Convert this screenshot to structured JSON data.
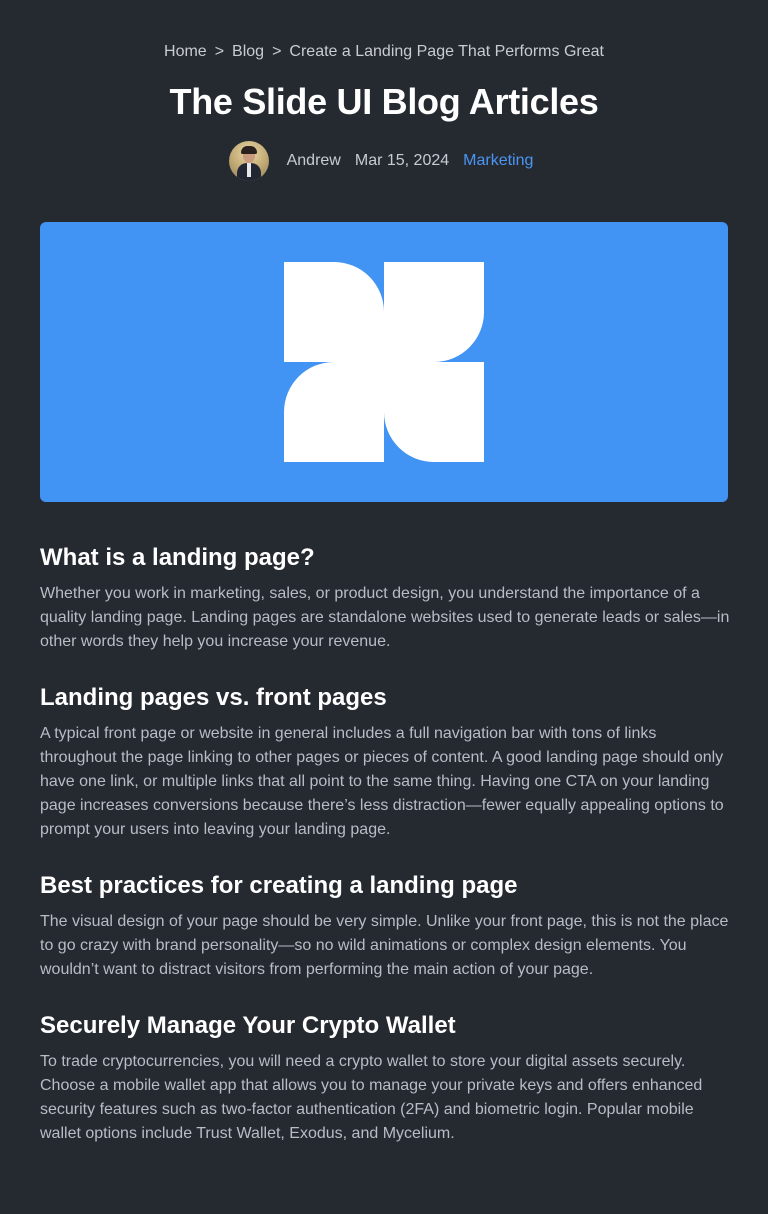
{
  "breadcrumb": {
    "home": "Home",
    "sep1": ">",
    "blog": "Blog",
    "sep2": ">",
    "current": "Create a Landing Page That Performs Great"
  },
  "title": "The Slide UI Blog Articles",
  "meta": {
    "author": "Andrew",
    "date": "Mar 15, 2024",
    "category": "Marketing"
  },
  "colors": {
    "background": "#252a31",
    "accent": "#4294f4",
    "link": "#4c95f2"
  },
  "hero": {
    "logo_icon": "quarter-circles-logo"
  },
  "sections": [
    {
      "heading": "What is a landing page?",
      "body": "Whether you work in marketing, sales, or product design, you understand the importance of a quality landing page. Landing pages are standalone websites used to generate leads or sales—in other words they help you increase your revenue."
    },
    {
      "heading": "Landing pages vs. front pages",
      "body": "A typical front page or website in general includes a full navigation bar with tons of links throughout the page linking to other pages or pieces of content. A good landing page should only have one link, or multiple links that all point to the same thing. Having one CTA on your landing page increases conversions because there’s less distraction—fewer equally appealing options to prompt your users into leaving your landing page."
    },
    {
      "heading": "Best practices for creating a landing page",
      "body": "The visual design of your page should be very simple. Unlike your front page, this is not the place to go crazy with brand personality—so no wild animations or complex design elements. You wouldn’t want to distract visitors from performing the main action of your page."
    },
    {
      "heading": "Securely Manage Your Crypto Wallet",
      "body": "To trade cryptocurrencies, you will need a crypto wallet to store your digital assets securely. Choose a mobile wallet app that allows you to manage your private keys and offers enhanced security features such as two-factor authentication (2FA) and biometric login. Popular mobile wallet options include Trust Wallet, Exodus, and Mycelium."
    }
  ]
}
